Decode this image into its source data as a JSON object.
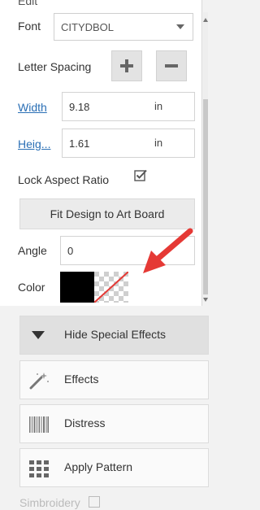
{
  "panel": {
    "top_label": "Edit",
    "font_label": "Font",
    "font_value": "CITYDBOL",
    "letter_spacing_label": "Letter Spacing",
    "width_label": "Width",
    "width_value": "9.18",
    "width_unit": "in",
    "height_label": "Heig...",
    "height_value": "1.61",
    "height_unit": "in",
    "lock_label": "Lock Aspect Ratio",
    "lock_checked": true,
    "fit_button": "Fit Design to Art Board",
    "angle_label": "Angle",
    "angle_value": "0",
    "color_label": "Color",
    "color_fill": "#000000"
  },
  "effects": {
    "hide_label": "Hide Special Effects",
    "effects_label": "Effects",
    "distress_label": "Distress",
    "pattern_label": "Apply Pattern",
    "simbroidery_label": "Simbroidery"
  },
  "icons": {
    "plus": "plus-icon",
    "minus": "minus-icon",
    "check": "checkmark-icon",
    "triangle": "triangle-down-icon",
    "wand": "magic-wand-icon",
    "barcode": "barcode-icon",
    "grid": "grid-icon",
    "annotation_arrow": "red-arrow-annotation"
  },
  "colors": {
    "link": "#2a6fb5",
    "annotation": "#e53935"
  }
}
